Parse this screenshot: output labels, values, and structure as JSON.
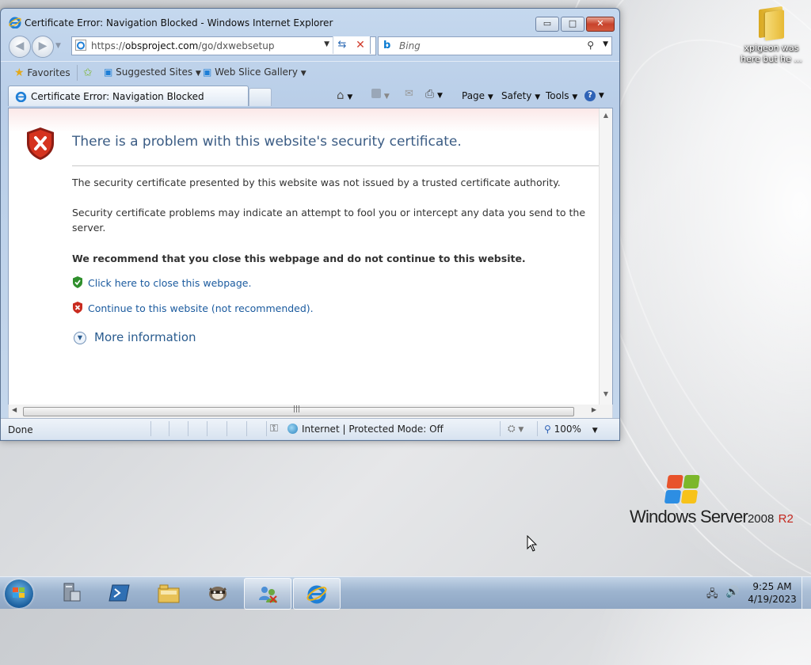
{
  "desktop": {
    "icon_label": "xpigeon was here but he ...",
    "brand": {
      "name": "Windows Server",
      "version": "2008",
      "edition": "R2"
    }
  },
  "window": {
    "title": "Certificate Error: Navigation Blocked - Windows Internet Explorer",
    "controls": {
      "minimize": "▭",
      "maximize": "□",
      "close": "✕"
    }
  },
  "address_bar": {
    "url_prefix": "https://",
    "url_domain": "obsproject.com",
    "url_path": "/go/dxwebsetup",
    "search_placeholder": "Bing"
  },
  "favorites_bar": {
    "favorites": "Favorites",
    "suggested_sites": "Suggested Sites",
    "web_slice_gallery": "Web Slice Gallery"
  },
  "tab": {
    "title": "Certificate Error: Navigation Blocked"
  },
  "command_bar": {
    "page": "Page",
    "safety": "Safety",
    "tools": "Tools"
  },
  "content": {
    "heading": "There is a problem with this website's security certificate.",
    "para1": "The security certificate presented by this website was not issued by a trusted certificate authority.",
    "para2": "Security certificate problems may indicate an attempt to fool you or intercept any data you send to the server.",
    "recommendation": "We recommend that you close this webpage and do not continue to this website.",
    "close_link": "Click here to close this webpage.",
    "continue_link": "Continue to this website (not recommended).",
    "more_info": "More information"
  },
  "status_bar": {
    "status": "Done",
    "zone": "Internet | Protected Mode: Off",
    "zoom": "100%"
  },
  "taskbar": {
    "time": "9:25 AM",
    "date": "4/19/2023"
  },
  "colors": {
    "link": "#1a5a9e",
    "heading": "#3b5c84",
    "error_red": "#c4261d"
  }
}
